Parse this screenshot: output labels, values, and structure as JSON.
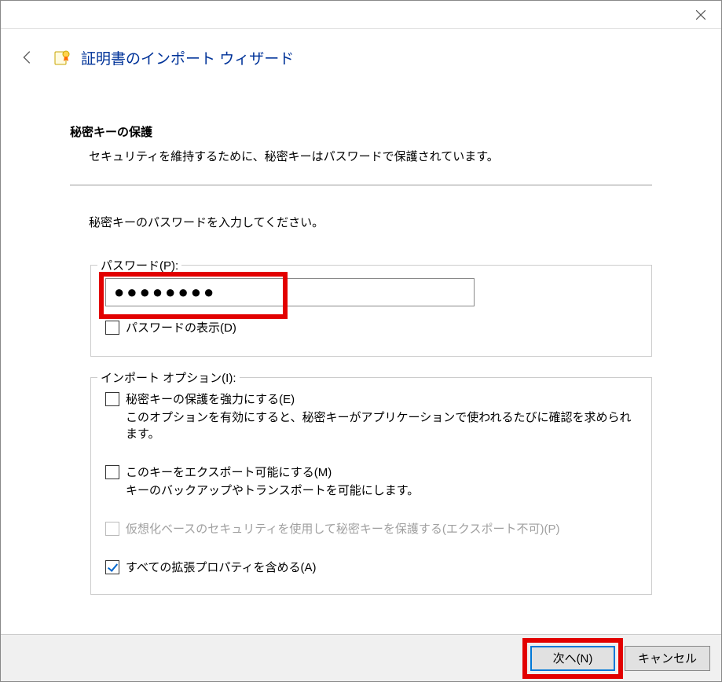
{
  "wizard": {
    "title": "証明書のインポート ウィザード"
  },
  "section": {
    "heading": "秘密キーの保護",
    "description": "セキュリティを維持するために、秘密キーはパスワードで保護されています。"
  },
  "prompt": "秘密キーのパスワードを入力してください。",
  "password_group": {
    "legend": "パスワード(P):",
    "value": "●●●●●●●●",
    "show_password_label": "パスワードの表示(D)"
  },
  "import_options": {
    "legend": "インポート オプション(I):",
    "strong": {
      "label": "秘密キーの保護を強力にする(E)",
      "sub": "このオプションを有効にすると、秘密キーがアプリケーションで使われるたびに確認を求められます。"
    },
    "exportable": {
      "label": "このキーをエクスポート可能にする(M)",
      "sub": "キーのバックアップやトランスポートを可能にします。"
    },
    "vbs": {
      "label": "仮想化ベースのセキュリティを使用して秘密キーを保護する(エクスポート不可)(P)"
    },
    "all_ext": {
      "label": "すべての拡張プロパティを含める(A)"
    }
  },
  "footer": {
    "next": "次へ(N)",
    "cancel": "キャンセル"
  }
}
